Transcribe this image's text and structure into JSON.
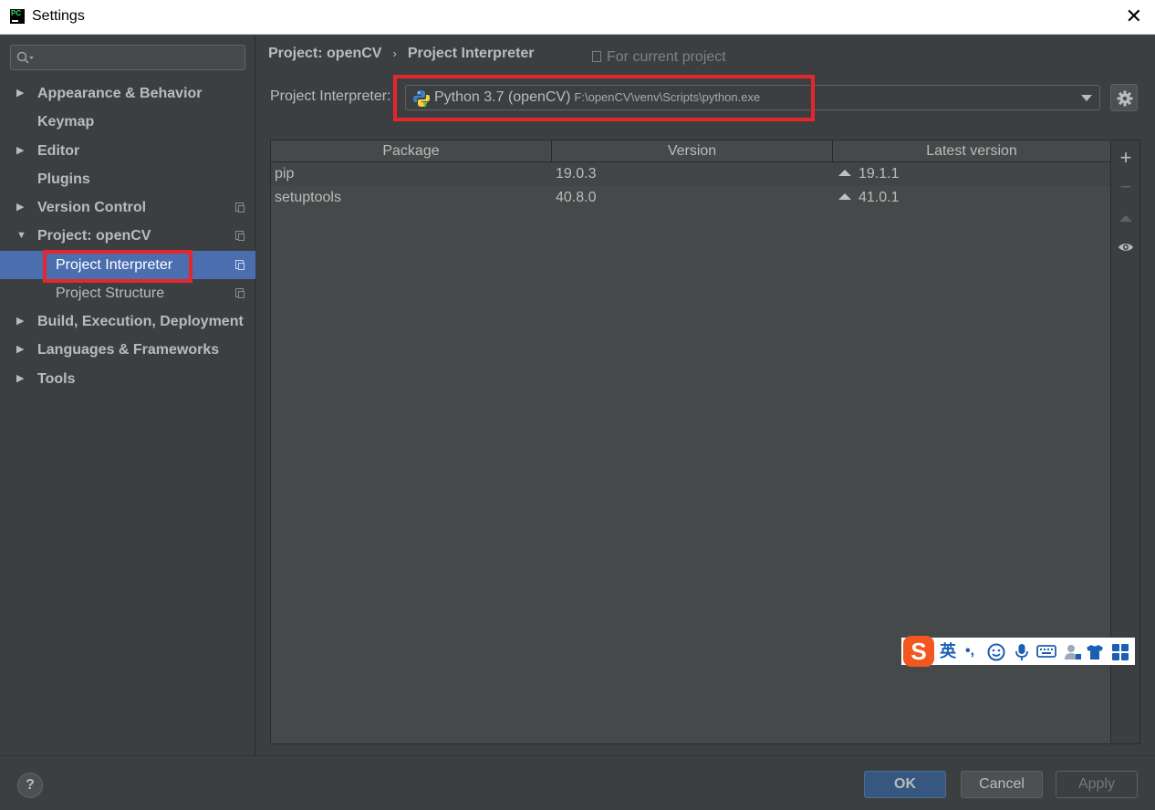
{
  "window": {
    "title": "Settings",
    "app_icon": "pycharm-icon",
    "close_glyph": "✕"
  },
  "sidebar": {
    "search": {
      "value": "",
      "placeholder": ""
    },
    "items": [
      {
        "label": "Appearance & Behavior",
        "expandable": true,
        "expanded": false
      },
      {
        "label": "Keymap",
        "expandable": false
      },
      {
        "label": "Editor",
        "expandable": true,
        "expanded": false
      },
      {
        "label": "Plugins",
        "expandable": false
      },
      {
        "label": "Version Control",
        "expandable": true,
        "expanded": false,
        "project_scoped": true
      },
      {
        "label": "Project: openCV",
        "expandable": true,
        "expanded": true,
        "project_scoped": true
      },
      {
        "label": "Project Interpreter",
        "child": true,
        "selected": true,
        "project_scoped": true
      },
      {
        "label": "Project Structure",
        "child": true,
        "project_scoped": true
      },
      {
        "label": "Build, Execution, Deployment",
        "expandable": true,
        "expanded": false
      },
      {
        "label": "Languages & Frameworks",
        "expandable": true,
        "expanded": false
      },
      {
        "label": "Tools",
        "expandable": true,
        "expanded": false
      }
    ]
  },
  "header": {
    "breadcrumb": [
      "Project: openCV",
      "Project Interpreter"
    ],
    "breadcrumb_sep": "›",
    "scope_note": "For current project"
  },
  "interpreter": {
    "label": "Project Interpreter:",
    "name": "Python 3.7 (openCV)",
    "path": "F:\\openCV\\venv\\Scripts\\python.exe"
  },
  "packages": {
    "columns": [
      "Package",
      "Version",
      "Latest version"
    ],
    "rows": [
      {
        "package": "pip",
        "version": "19.0.3",
        "latest": "19.1.1",
        "upgrade_available": true
      },
      {
        "package": "setuptools",
        "version": "40.8.0",
        "latest": "41.0.1",
        "upgrade_available": true
      }
    ]
  },
  "side_tools": {
    "add": "+",
    "remove": "−",
    "upgrade": "upgrade-icon",
    "show_early": "eye-icon"
  },
  "ime_toolbar": {
    "logo": "S",
    "lang": "英",
    "punct": "•,",
    "items": [
      "emoji-icon",
      "mic-icon",
      "keyboard-icon",
      "user-icon",
      "skin-icon",
      "grid-icon"
    ]
  },
  "footer": {
    "help": "?",
    "ok": "OK",
    "cancel": "Cancel",
    "apply": "Apply"
  },
  "colors": {
    "highlight": "#e5262c",
    "selection": "#4b6eaf",
    "bg": "#3c3f41"
  }
}
